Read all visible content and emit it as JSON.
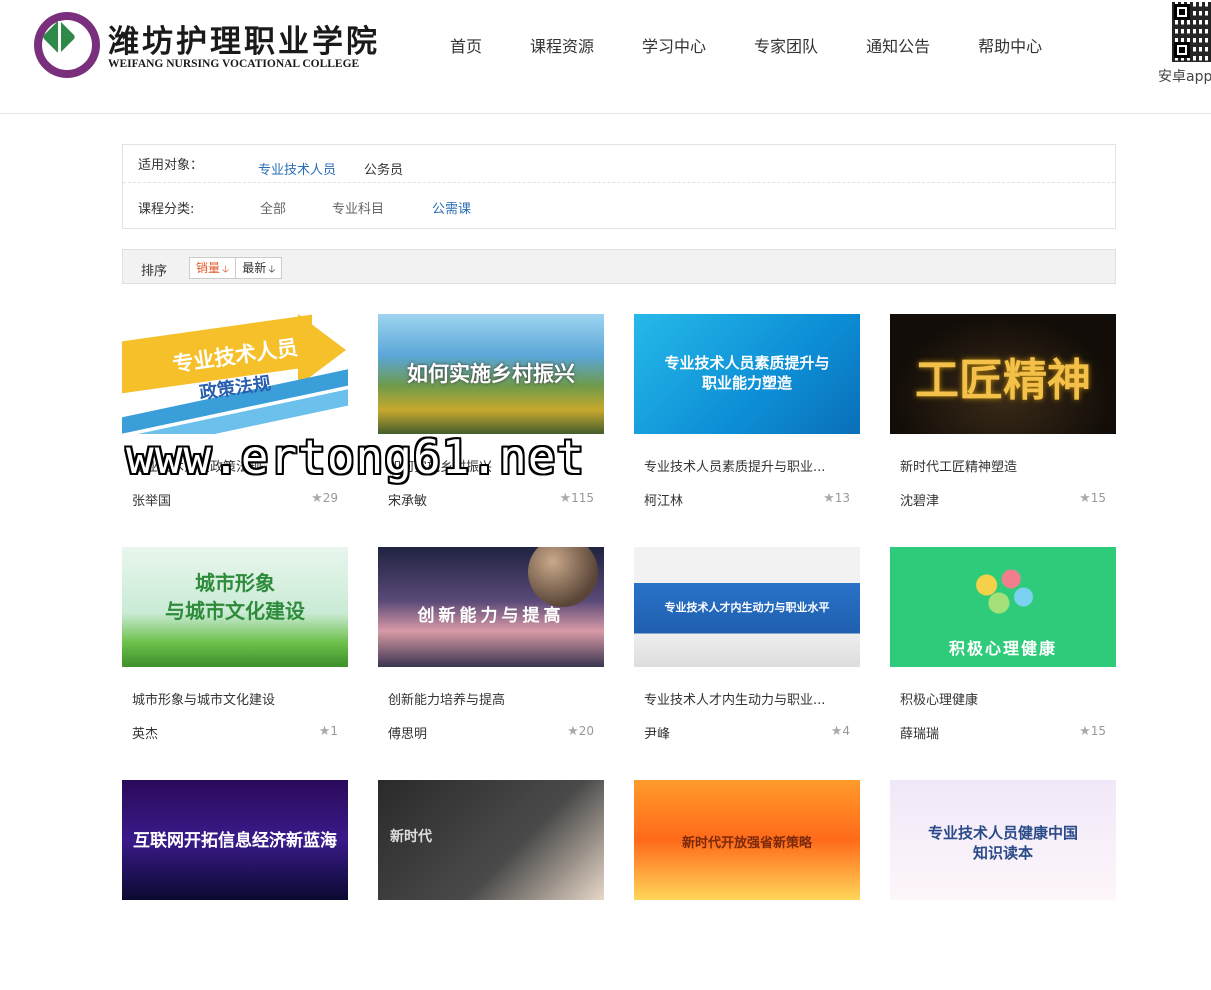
{
  "header": {
    "logo_cn": "潍坊护理职业学院",
    "logo_en": "WEIFANG NURSING VOCATIONAL COLLEGE",
    "nav": [
      "首页",
      "课程资源",
      "学习中心",
      "专家团队",
      "通知公告",
      "帮助中心"
    ],
    "qr_label": "安卓app"
  },
  "filters": {
    "audience_label": "适用对象：",
    "audience_options": [
      "专业技术人员",
      "公务员"
    ],
    "audience_active": "专业技术人员",
    "category_label": "课程分类:",
    "category_options": [
      "全部",
      "专业科目",
      "公需课"
    ],
    "category_active": "公需课"
  },
  "sort": {
    "label": "排序",
    "buttons": [
      "销量",
      "最新"
    ],
    "active": "销量"
  },
  "courses": [
    {
      "thumb_text": [
        "专业技术人员",
        "政策法规"
      ],
      "title": "专业技术人员政策法规",
      "author": "张举国",
      "rating": "29"
    },
    {
      "thumb_text": [
        "如何实施乡村振兴"
      ],
      "title": "如何实施乡村振兴",
      "author": "宋承敏",
      "rating": "115"
    },
    {
      "thumb_text": [
        "专业技术人员素质提升与",
        "职业能力塑造"
      ],
      "title": "专业技术人员素质提升与职业...",
      "author": "柯江林",
      "rating": "13"
    },
    {
      "thumb_text": [
        "工匠精神"
      ],
      "title": "新时代工匠精神塑造",
      "author": "沈碧津",
      "rating": "15"
    },
    {
      "thumb_text": [
        "城市形象",
        "与城市文化建设"
      ],
      "title": "城市形象与城市文化建设",
      "author": "英杰",
      "rating": "1"
    },
    {
      "thumb_text": [
        "创新能力与提高"
      ],
      "title": "创新能力培养与提高",
      "author": "傅思明",
      "rating": "20"
    },
    {
      "thumb_text": [
        "专业技术人才内生动力与职业水平"
      ],
      "title": "专业技术人才内生动力与职业...",
      "author": "尹峰",
      "rating": "4"
    },
    {
      "thumb_text": [
        "积极心理健康"
      ],
      "title": "积极心理健康",
      "author": "薛瑞瑞",
      "rating": "15"
    },
    {
      "thumb_text": [
        "互联网开拓信息经济新蓝海"
      ],
      "title": "",
      "author": "",
      "rating": ""
    },
    {
      "thumb_text": [
        "新时代"
      ],
      "title": "",
      "author": "",
      "rating": ""
    },
    {
      "thumb_text": [
        "新时代开放强省新策略"
      ],
      "title": "",
      "author": "",
      "rating": ""
    },
    {
      "thumb_text": [
        "专业技术人员健康中国",
        "知识读本"
      ],
      "title": "",
      "author": "",
      "rating": ""
    }
  ],
  "watermark": "www.ertong61.net"
}
